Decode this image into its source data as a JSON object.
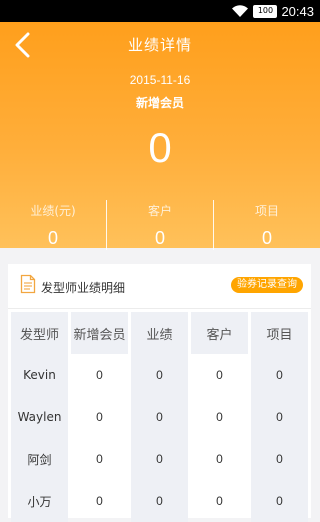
{
  "status_bar": {
    "battery": "100",
    "time": "20:43"
  },
  "header": {
    "title": "业绩详情",
    "date": "2015-11-16",
    "metric_label": "新增会员",
    "metric_value": "0",
    "stats": [
      {
        "label": "业绩(元)",
        "value": "0"
      },
      {
        "label": "客户",
        "value": "0"
      },
      {
        "label": "项目",
        "value": "0"
      }
    ]
  },
  "card": {
    "title": "发型师业绩明细",
    "query_button": "验券记录查询",
    "columns": [
      "发型师",
      "新增会员",
      "业绩",
      "客户",
      "项目"
    ],
    "rows": [
      [
        "Kevin",
        "0",
        "0",
        "0",
        "0"
      ],
      [
        "Waylen",
        "0",
        "0",
        "0",
        "0"
      ],
      [
        "阿剑",
        "0",
        "0",
        "0",
        "0"
      ],
      [
        "小万",
        "0",
        "0",
        "0",
        "0"
      ]
    ]
  }
}
